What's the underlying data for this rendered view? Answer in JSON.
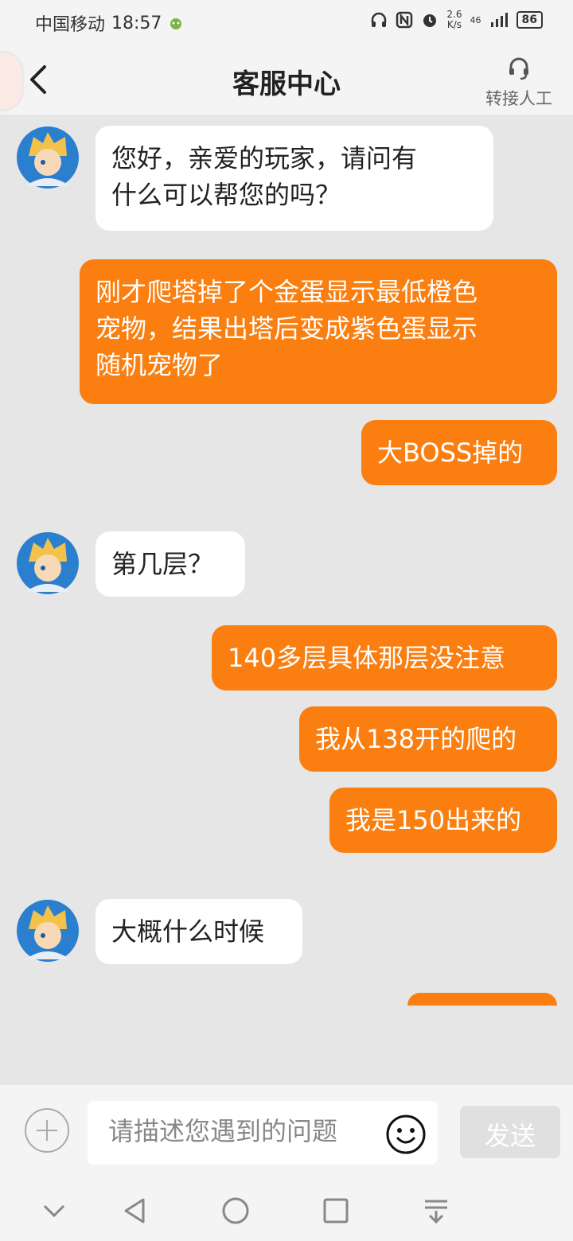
{
  "status_bar": {
    "carrier": "中国移动",
    "time": "18:57",
    "net_speed_value": "2.6",
    "net_speed_unit": "K/s",
    "signal": "46",
    "battery": "86"
  },
  "header": {
    "title": "客服中心",
    "transfer_label": "转接人工"
  },
  "messages": [
    {
      "side": "left",
      "text": "您好，亲爱的玩家，请问有\n什么可以帮您的吗？"
    },
    {
      "side": "right",
      "text": "刚才爬塔掉了个金蛋显示最低橙色\n宠物，结果出塔后变成紫色蛋显示\n随机宠物了"
    },
    {
      "side": "right",
      "text": "大BOSS掉的"
    },
    {
      "side": "left",
      "text": "第几层？"
    },
    {
      "side": "right",
      "text": "140多层具体那层没注意"
    },
    {
      "side": "right",
      "text": "我从138开的爬的"
    },
    {
      "side": "right",
      "text": "我是150出来的"
    },
    {
      "side": "left",
      "text": "大概什么时候"
    }
  ],
  "input_bar": {
    "placeholder": "请描述您遇到的问题",
    "send_label": "发送"
  },
  "colors": {
    "accent": "#fa7f10",
    "background": "#e6e6e6",
    "agent_bubble": "#ffffff"
  },
  "icons": {
    "back": "chevron-left-icon",
    "transfer": "headset-icon",
    "plus": "plus-circle-icon",
    "emoji": "smiley-icon"
  }
}
